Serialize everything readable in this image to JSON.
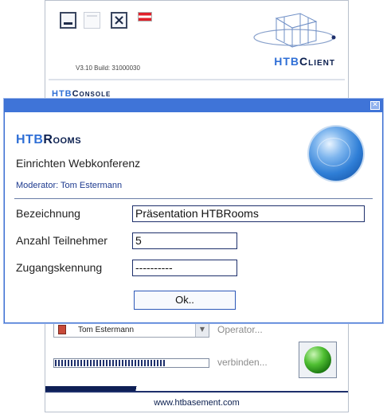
{
  "client": {
    "version": "V3.10 Build: 31000030",
    "logo": {
      "prefix": "HTB",
      "suffix": "Client"
    },
    "console_title": {
      "prefix": "HTB",
      "suffix": "Console"
    },
    "user_name": "Tom Estermann",
    "operator_label": "Operator...",
    "connect_label": "verbinden...",
    "connect_progress": 0.72,
    "footer_url": "www.htbasement.com",
    "window_buttons": [
      "minimize-icon",
      "maximize-icon",
      "close-icon",
      "austria-flag-icon"
    ]
  },
  "dialog": {
    "close_glyph": "✕",
    "logo": {
      "prefix": "HTB",
      "suffix": "Rooms"
    },
    "heading": "Einrichten Webkonferenz",
    "moderator": "Moderator: Tom Estermann",
    "fields": {
      "bezeichnung": {
        "label": "Bezeichnung",
        "value": "Präsentation HTBRooms"
      },
      "teilnehmer": {
        "label": "Anzahl Teilnehmer",
        "value": "5"
      },
      "kennung": {
        "label": "Zugangskennung",
        "value": "----------"
      }
    },
    "ok_label": "Ok..",
    "globe_icon": "globe-icon"
  },
  "colors": {
    "titlebar": "#3f74d8",
    "brand_dark": "#0b1f4f",
    "brand_accent": "#2f6fd6"
  }
}
